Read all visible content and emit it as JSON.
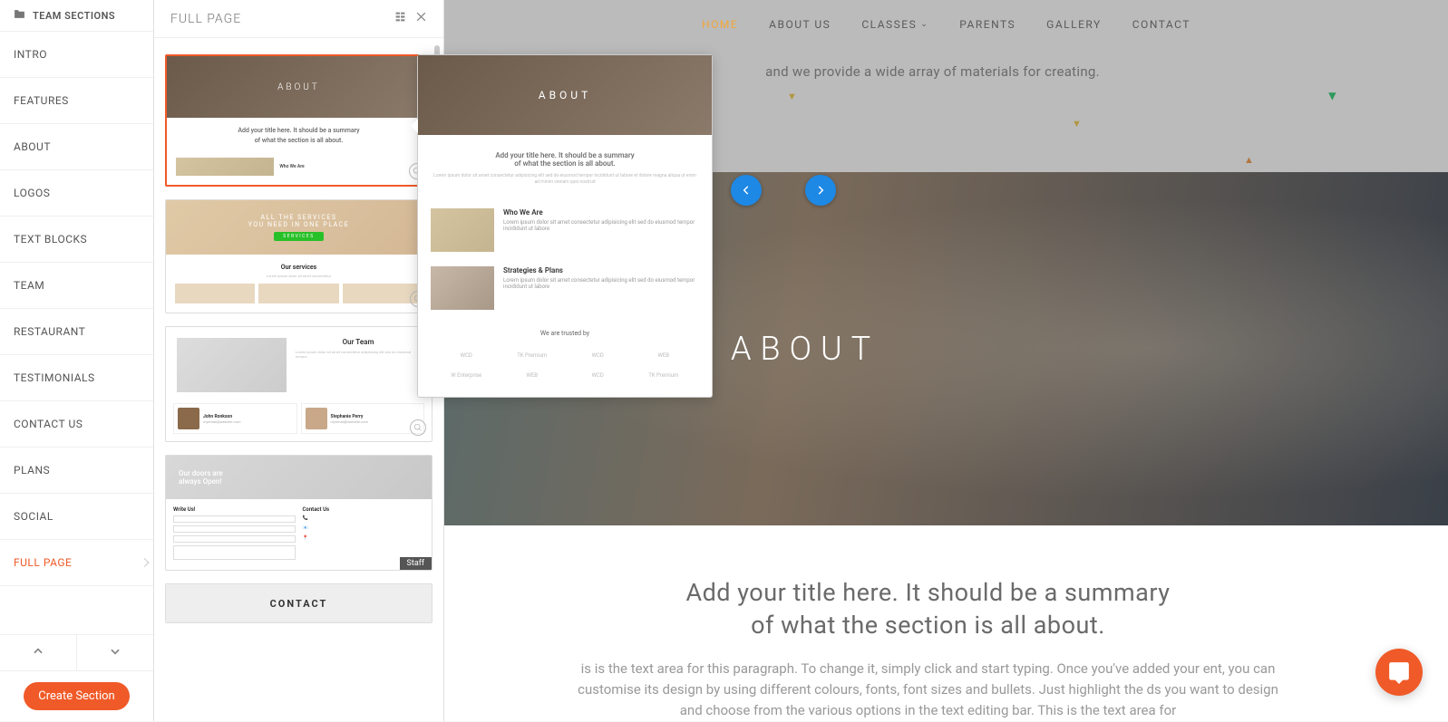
{
  "sidebar": {
    "header": "TEAM SECTIONS",
    "items": [
      {
        "label": "INTRO"
      },
      {
        "label": "FEATURES"
      },
      {
        "label": "ABOUT"
      },
      {
        "label": "LOGOS"
      },
      {
        "label": "TEXT BLOCKS"
      },
      {
        "label": "TEAM"
      },
      {
        "label": "RESTAURANT"
      },
      {
        "label": "TESTIMONIALS"
      },
      {
        "label": "CONTACT US"
      },
      {
        "label": "PLANS"
      },
      {
        "label": "SOCIAL"
      },
      {
        "label": "FULL PAGE",
        "active": true
      }
    ],
    "create_button": "Create Section"
  },
  "panel": {
    "title": "FULL PAGE",
    "thumbs": {
      "about": {
        "hero": "ABOUT",
        "line1": "Add your title here. It should be a summary",
        "line2": "of what the section is all about.",
        "who": "Who We Are"
      },
      "services": {
        "hero1": "ALL THE SERVICES",
        "hero2": "YOU NEED IN ONE PLACE",
        "btn": "SERVICES",
        "title": "Our services"
      },
      "team": {
        "title": "Our Team",
        "p1_name": "John Ronkson",
        "p1_role": "myemail@website.com",
        "p2_name": "Stephanie Perry",
        "p2_role": "myemail@website.com"
      },
      "contact": {
        "doors1": "Our doors are",
        "doors2": "always Open!",
        "write": "Write Us!",
        "contactus": "Contact Us",
        "staff": "Staff"
      },
      "bottom": {
        "hero": "CONTACT"
      }
    }
  },
  "preview": {
    "hero": "ABOUT",
    "line1": "Add your title here. It should be a summary",
    "line2": "of what the section is all about.",
    "row1_title": "Who We Are",
    "row2_title": "Strategies & Plans",
    "trust": "We are trusted by",
    "logos": [
      "WCD",
      "TK Premium",
      "WCD",
      "WEB",
      "W Enterprise",
      "WEB",
      "WCD",
      "TK Premium"
    ]
  },
  "canvas": {
    "nav": [
      {
        "label": "HOME",
        "current": true
      },
      {
        "label": "ABOUT US"
      },
      {
        "label": "CLASSES",
        "dropdown": true
      },
      {
        "label": "PARENTS"
      },
      {
        "label": "GALLERY"
      },
      {
        "label": "CONTACT"
      }
    ],
    "bg_text": "and we provide a wide array of materials for creating.",
    "hero": "ABOUT",
    "title1": "Add your title here. It should be a summary",
    "title2": "of what the section is all about.",
    "paragraph": "is is the text area for this paragraph. To change it, simply click and start typing. Once you've added your ent, you can customise its design by using different colours, fonts, font sizes and bullets. Just highlight the ds you want to design and choose from the various options in the text editing bar.  This is the text area for"
  }
}
